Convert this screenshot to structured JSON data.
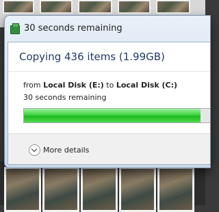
{
  "window": {
    "title": "30 seconds remaining"
  },
  "copy": {
    "heading": "Copying 436 items (1.99GB)",
    "from_prefix": "from",
    "source": "Local Disk (E:)",
    "to_word": "to",
    "destination": "Local Disk (C:)",
    "time_remaining": "30 seconds remaining",
    "progress_fraction": 0.95,
    "progress_color": "#2fc52f"
  },
  "footer": {
    "more_details_label": "More details"
  }
}
